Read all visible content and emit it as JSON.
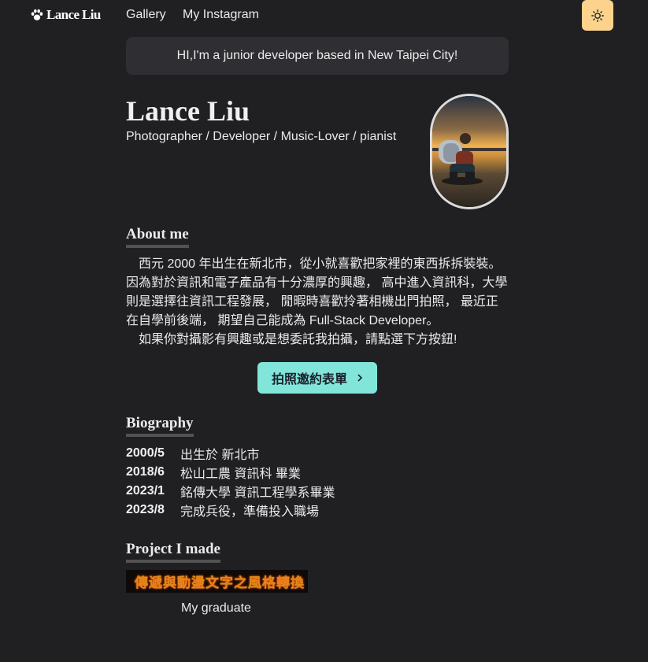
{
  "nav": {
    "logo_text": "Lance Liu",
    "links": [
      "Gallery",
      "My Instagram"
    ]
  },
  "theme_toggle_icon": "sun-icon",
  "banner": "HI,I'm a junior developer based in New Taipei City!",
  "profile": {
    "name": "Lance Liu",
    "subtitle": "Photographer / Developer / Music-Lover / pianist"
  },
  "about": {
    "title": "About me",
    "paragraphs": [
      "西元 2000 年出生在新北市，從小就喜歡把家裡的東西拆拆裝裝。因為對於資訊和電子產品有十分濃厚的興趣， 高中進入資訊科，大學則是選擇往資訊工程發展， 閒暇時喜歡拎著相機出門拍照， 最近正在自學前後端， 期望自己能成為 Full-Stack Developer。",
      "如果你對攝影有興趣或是想委託我拍攝，請點選下方按鈕!"
    ],
    "cta_label": "拍照邀約表單"
  },
  "biography": {
    "title": "Biography",
    "items": [
      {
        "year": "2000/5",
        "text": "出生於 新北市"
      },
      {
        "year": "2018/6",
        "text": "松山工農 資訊科 畢業"
      },
      {
        "year": "2023/1",
        "text": "銘傳大學 資訊工程學系畢業"
      },
      {
        "year": "2023/8",
        "text": "完成兵役，準備投入職場"
      }
    ]
  },
  "projects": {
    "title": "Project I made",
    "items": [
      {
        "image_text": "傳遞與動盪文字之風格轉換",
        "caption": "My graduate"
      }
    ]
  },
  "colors": {
    "background": "#202023",
    "accent": "#81e6d9",
    "theme_button": "#fbd38d"
  }
}
